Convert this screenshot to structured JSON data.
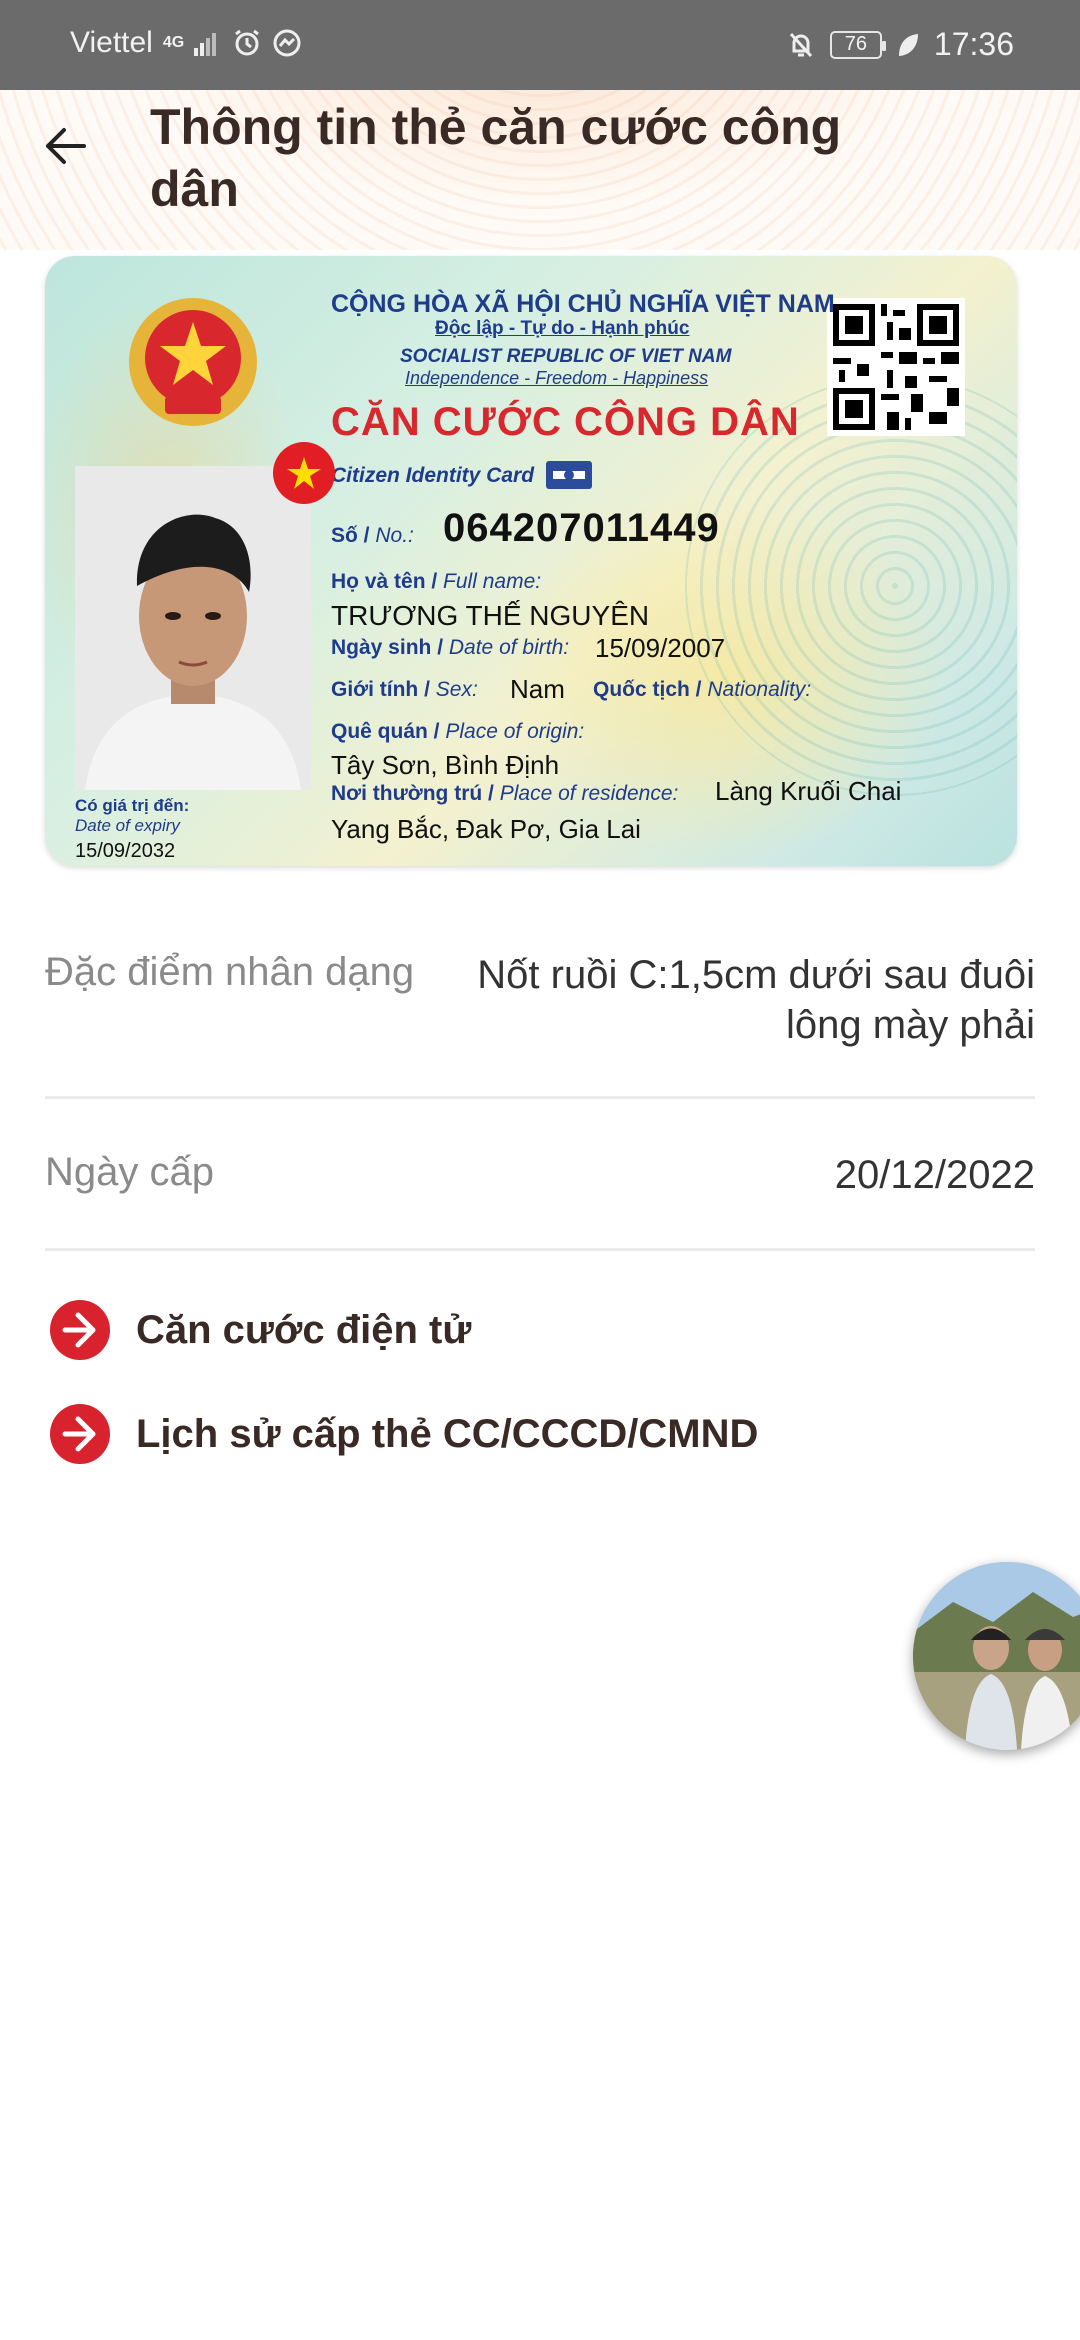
{
  "status_bar": {
    "carrier": "Viettel",
    "network": "4G",
    "battery": "76",
    "time": "17:36"
  },
  "header": {
    "title": "Thông tin thẻ căn cước công dân",
    "back_icon": "arrow-left-icon"
  },
  "id_card": {
    "republic": "CỘNG HÒA XÃ HỘI CHỦ NGHĨA VIỆT NAM",
    "motto": "Độc lập - Tự do - Hạnh phúc",
    "republic_en": "SOCIALIST REPUBLIC OF VIET NAM",
    "motto_en": "Independence - Freedom - Happiness",
    "card_title": "CĂN CƯỚC CÔNG DÂN",
    "card_title_en": "Citizen Identity Card",
    "number_label": "Số",
    "number_label_en": "No.:",
    "number": "064207011449",
    "name_label": "Họ và tên",
    "name_label_en": "Full name:",
    "name": "TRƯƠNG THẾ NGUYÊN",
    "dob_label": "Ngày sinh",
    "dob_label_en": "Date of birth:",
    "dob": "15/09/2007",
    "sex_label": "Giới tính",
    "sex_label_en": "Sex:",
    "sex": "Nam",
    "nationality_label": "Quốc tịch",
    "nationality_label_en": "Nationality:",
    "origin_label": "Quê quán",
    "origin_label_en": "Place of origin:",
    "origin": "Tây Sơn, Bình Định",
    "residence_label": "Nơi thường trú",
    "residence_label_en": "Place of residence:",
    "residence_line1": "Làng Kruối Chai",
    "residence_line2": "Yang Bắc, Đak Pơ, Gia Lai",
    "expiry_label": "Có giá trị đến:",
    "expiry_label_en": "Date of expiry",
    "expiry": "15/09/2032",
    "colors": {
      "title_red": "#d8282e",
      "label_navy": "#1f3c8a",
      "flag_red": "#e01e24",
      "star_yellow": "#ffde00"
    }
  },
  "details": {
    "features_label": "Đặc điểm nhân dạng",
    "features_value": "Nốt ruồi C:1,5cm dưới sau đuôi lông mày phải",
    "issue_date_label": "Ngày cấp",
    "issue_date_value": "20/12/2022"
  },
  "links": [
    {
      "label": "Căn cước điện tử",
      "icon": "arrow-right-circle-icon"
    },
    {
      "label": "Lịch sử cấp thẻ CC/CCCD/CMND",
      "icon": "arrow-right-circle-icon"
    }
  ],
  "theme": {
    "accent_red": "#d8222e",
    "title_color": "#3a2a26",
    "label_gray": "#8a8a8a"
  }
}
